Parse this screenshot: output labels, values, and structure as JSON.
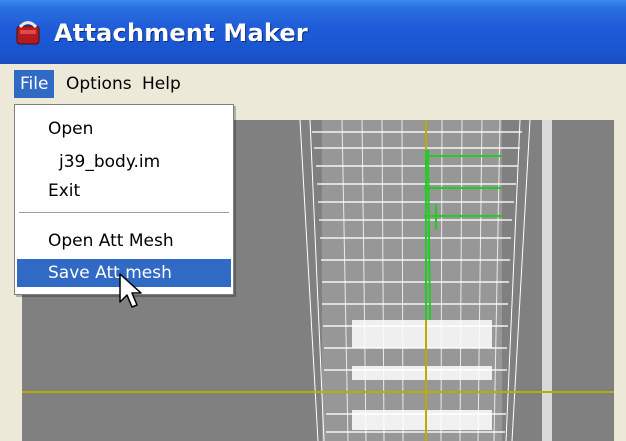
{
  "window": {
    "title": "Attachment Maker",
    "title_color": "#ffffff",
    "titlebar_color": "#1f5bd8"
  },
  "menubar": {
    "items": [
      {
        "label": "File",
        "active": true
      },
      {
        "label": "Options",
        "active": false
      },
      {
        "label": "Help",
        "active": false
      }
    ]
  },
  "file_menu": {
    "items": [
      {
        "label": "Open"
      },
      {
        "label": "j39_body.im"
      },
      {
        "label": "Exit"
      },
      {
        "label": "Open Att Mesh"
      },
      {
        "label": "Save Att mesh",
        "selected": true
      }
    ],
    "highlight_color": "#316ac5"
  },
  "viewport": {
    "background": "#808080",
    "mesh_color": "#ffffff",
    "axis_color": "#b5b000",
    "attachment_color": "#22cc22"
  },
  "icons": {
    "app": "app-icon",
    "cursor": "mouse-pointer-icon"
  }
}
